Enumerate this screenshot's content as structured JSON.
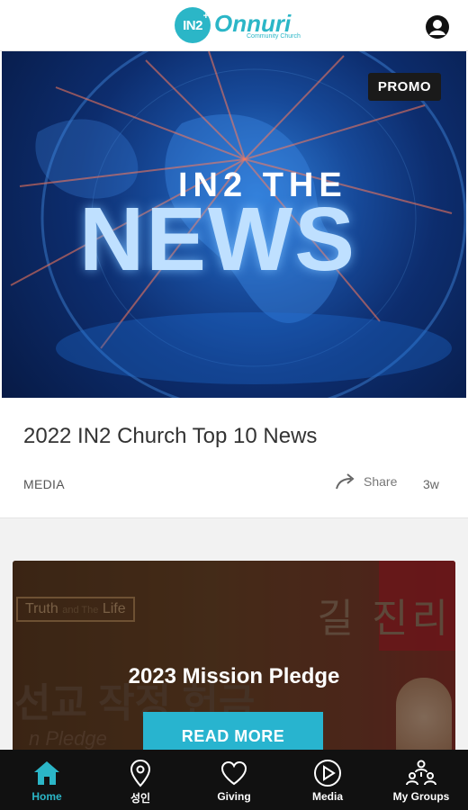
{
  "header": {
    "logo_badge": "IN2",
    "logo_plus": "+",
    "logo_name": "Onnuri",
    "logo_sub": "Community Church"
  },
  "feed": {
    "card1": {
      "badge": "PROMO",
      "hero_line1": "IN2 THE",
      "hero_line2": "NEWS",
      "title": "2022 IN2 Church Top 10 News",
      "category": "MEDIA",
      "share_label": "Share",
      "age": "3w"
    },
    "card2": {
      "bg_truth": "Truth",
      "bg_and": "and The",
      "bg_life": "Life",
      "bg_korean_top": "길 진리",
      "bg_korean_bottom": "선교 작정 헌금",
      "bg_pledge": "n Pledge",
      "title": "2023 Mission Pledge",
      "button_label": "READ MORE"
    }
  },
  "bottom_nav": {
    "items": [
      {
        "label": "Home",
        "icon": "home-icon"
      },
      {
        "label": "성인",
        "icon": "location-pin-icon"
      },
      {
        "label": "Giving",
        "icon": "heart-icon"
      },
      {
        "label": "Media",
        "icon": "play-circle-icon"
      },
      {
        "label": "My Groups",
        "icon": "groups-icon"
      }
    ],
    "active_index": 0,
    "active_color": "#2bb6c7"
  }
}
